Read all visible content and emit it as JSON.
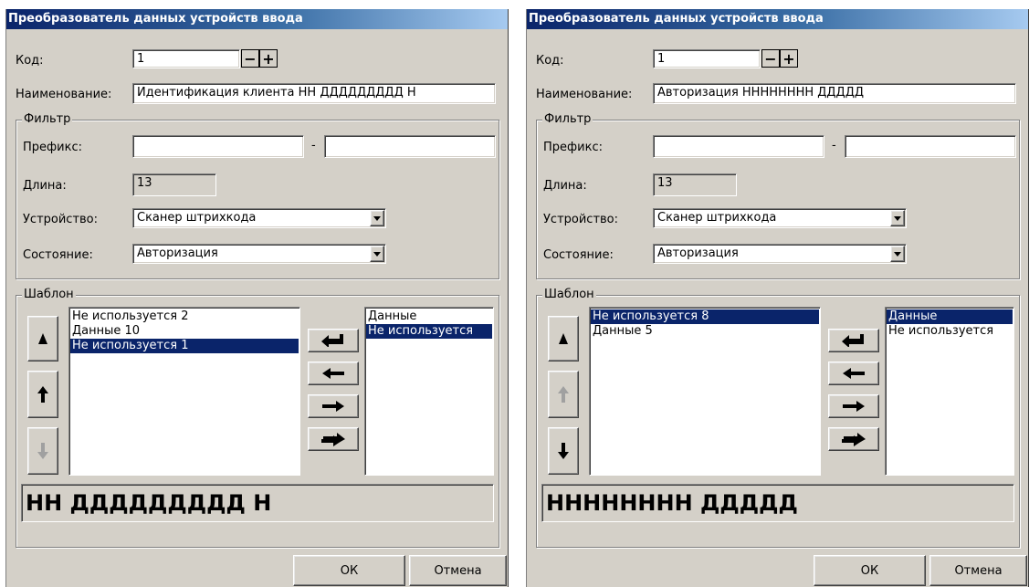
{
  "dialogs": [
    {
      "title": "Преобразователь данных устройств ввода",
      "code_label": "Код:",
      "code_value": "1",
      "stepper_minus": "−",
      "stepper_plus": "+",
      "name_label": "Наименование:",
      "name_value": "Идентификация клиента НН ДДДДДДДДД Н",
      "filter_title": "Фильтр",
      "prefix_label": "Префикс:",
      "prefix_dash": "-",
      "prefix_from": "",
      "prefix_to": "",
      "length_label": "Длина:",
      "length_value": "13",
      "device_label": "Устройство:",
      "device_value": "Сканер штрихкода",
      "state_label": "Состояние:",
      "state_value": "Авторизация",
      "template_title": "Шаблон",
      "template_items": [
        "Не используется 2",
        "Данные 10",
        "Не используется 1"
      ],
      "template_selected_index": 2,
      "source_items": [
        "Данные",
        "Не используется"
      ],
      "source_selected_index": 1,
      "pattern_text": "НН ДДДДДДДДД Н",
      "ok_label": "ОК",
      "cancel_label": "Отмена",
      "move_up_enabled": true,
      "move_down_enabled": false
    },
    {
      "title": "Преобразователь данных устройств ввода",
      "code_label": "Код:",
      "code_value": "1",
      "stepper_minus": "−",
      "stepper_plus": "+",
      "name_label": "Наименование:",
      "name_value": "Авторизация НННННННН ДДДДД",
      "filter_title": "Фильтр",
      "prefix_label": "Префикс:",
      "prefix_dash": "-",
      "prefix_from": "",
      "prefix_to": "",
      "length_label": "Длина:",
      "length_value": "13",
      "device_label": "Устройство:",
      "device_value": "Сканер штрихкода",
      "state_label": "Состояние:",
      "state_value": "Авторизация",
      "template_title": "Шаблон",
      "template_items": [
        "Не используется 8",
        "Данные 5"
      ],
      "template_selected_index": 0,
      "source_items": [
        "Данные",
        "Не используется"
      ],
      "source_selected_index": 0,
      "pattern_text": "НННННННН ДДДДД",
      "ok_label": "ОК",
      "cancel_label": "Отмена",
      "move_up_enabled": false,
      "move_down_enabled": true
    }
  ],
  "icons": {
    "top": "triangle-up-icon",
    "up": "arrow-up-icon",
    "down": "arrow-down-icon",
    "insert": "return-arrow-icon",
    "remove": "arrow-left-icon",
    "add": "arrow-right-icon",
    "add_all": "double-arrow-right-icon",
    "combo": "chevron-down-icon"
  },
  "colors": {
    "face": "#d4d0c8",
    "title_start": "#0a246a",
    "title_end": "#a6caf0",
    "selection": "#0a246a",
    "disabled_icon": "#a0a0a0"
  }
}
